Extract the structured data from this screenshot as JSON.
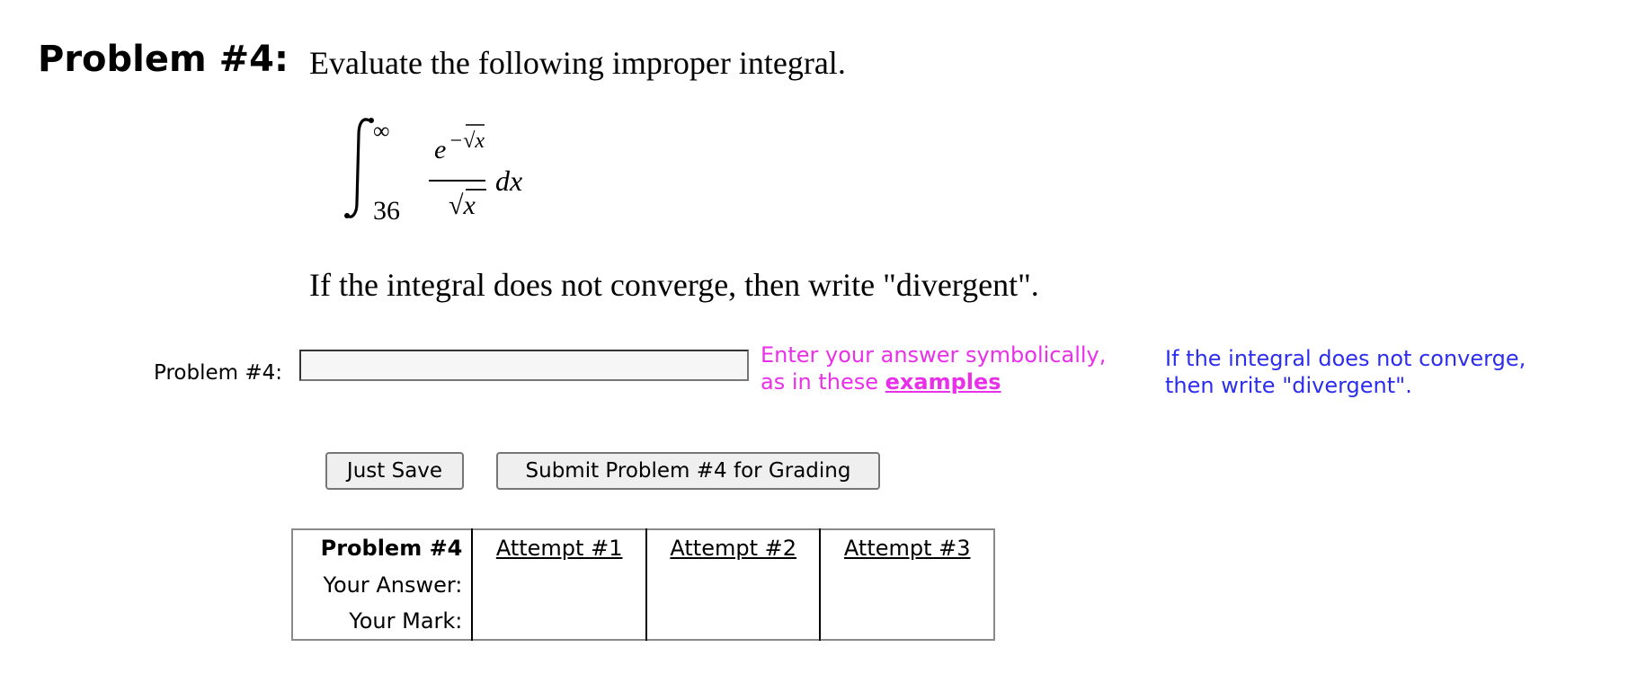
{
  "problem": {
    "heading": "Problem #4:",
    "statement": "Evaluate the following improper integral.",
    "integral": {
      "lower_limit": "36",
      "upper_limit": "∞",
      "numerator_base": "e",
      "numerator_exponent": "−√x",
      "denominator": "√x",
      "differential": "dx"
    },
    "instruction": "If the integral does not converge, then write \"divergent\"."
  },
  "answer": {
    "label": "Problem #4:",
    "value": "",
    "placeholder": "",
    "hint_line1": "Enter your answer symbolically,",
    "hint_line2_prefix": "as in these ",
    "hint_link": "examples",
    "note_line1": "If the integral does not converge,",
    "note_line2": "then write \"divergent\"."
  },
  "buttons": {
    "save": "Just Save",
    "submit": "Submit Problem #4 for Grading"
  },
  "attempts_table": {
    "header": "Problem #4",
    "attempts": [
      "Attempt #1",
      "Attempt #2",
      "Attempt #3"
    ],
    "row_labels": [
      "Your Answer:",
      "Your Mark:"
    ],
    "answers": [
      "",
      "",
      ""
    ],
    "marks": [
      "",
      "",
      ""
    ]
  },
  "colors": {
    "hint": "#e930e9",
    "note": "#2d2dee"
  }
}
